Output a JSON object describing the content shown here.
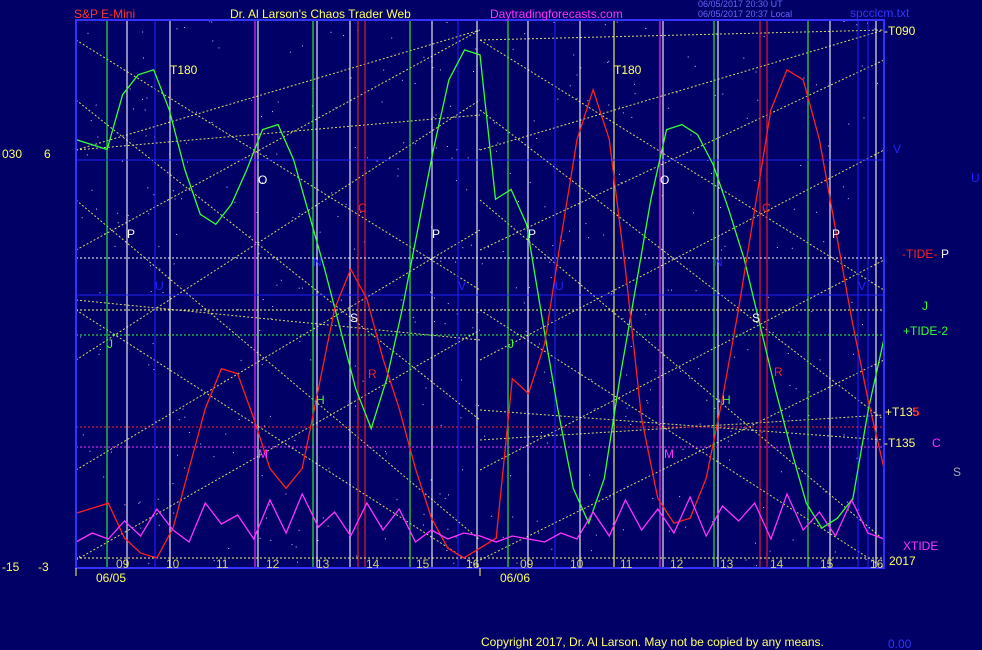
{
  "header": {
    "instrument": "S&P E-Mini",
    "site_title": "Dr. Al Larson's Chaos Trader Web",
    "site_link": "Daytradingforecasts.com",
    "timestamp_1": "06/05/2017 20:30 UT",
    "timestamp_2": "06/05/2017 20:37 Local",
    "file_name": "spcclcm.txt"
  },
  "left_axis": {
    "top_a": "030",
    "top_b": "6",
    "bottom_a": "-15",
    "bottom_b": "-3"
  },
  "right_labels": {
    "t090": "-T090",
    "v": "V",
    "u": "U",
    "tide": "-TIDE-",
    "tide_p": "P",
    "j": "J",
    "tide2": "+TIDE-2",
    "t135_plus": "+T135",
    "t135_plus_suffix": "5",
    "t135_minus": "-T135",
    "c": "C",
    "s": "S",
    "xtide": "XTIDE",
    "year": "2017"
  },
  "footer": {
    "copyright": "Copyright 2017, Dr. Al Larson. May not be copied by any means.",
    "tail": "0.00"
  },
  "colors": {
    "bg": "#000066",
    "plot_bg": "#000066",
    "frame": "#3333ff",
    "yellow": "#ffff66",
    "green": "#33ff33",
    "red": "#ff2020",
    "magenta": "#ff33ff",
    "white": "#ffffff",
    "blue": "#2222ff",
    "title_red": "#ff3333"
  },
  "chart_data": {
    "type": "line",
    "title": "S&P E-Mini",
    "dates": [
      "06/05",
      "06/06"
    ],
    "hour_ticks": [
      "09",
      "10",
      "11",
      "12",
      "13",
      "14",
      "15",
      "16"
    ],
    "flux_labels": [
      "T180",
      "T180",
      "O",
      "O",
      "N",
      "N",
      "P",
      "P",
      "P",
      "P",
      "S",
      "S",
      "C",
      "C",
      "R",
      "R",
      "H",
      "H",
      "J",
      "J",
      "M",
      "M",
      "U",
      "U",
      "V",
      "V"
    ],
    "series": [
      {
        "name": "TIDE-2",
        "color": "#33ff33",
        "values": [
          5.6,
          5.5,
          5.4,
          6.5,
          6.9,
          7.0,
          6.2,
          5.0,
          4.1,
          3.9,
          4.3,
          5.0,
          5.8,
          5.9,
          5.2,
          4.1,
          3.0,
          1.8,
          0.6,
          -0.2,
          0.8,
          2.2,
          3.8,
          5.4,
          6.8,
          7.4,
          7.3,
          4.4,
          4.6,
          3.9,
          2.0,
          0.2,
          -1.4,
          -2.1,
          -1.2,
          0.8,
          2.6,
          4.4,
          5.8,
          5.9,
          5.7,
          5.1,
          4.2,
          3.2,
          1.9,
          0.6,
          -0.6,
          -1.7,
          -2.2,
          -2.0,
          -1.6,
          0.2,
          1.6
        ]
      },
      {
        "name": "TIDE",
        "color": "#ff2020",
        "values": [
          -1.9,
          -1.8,
          -1.7,
          -2.4,
          -2.7,
          -2.8,
          -2.2,
          -1.0,
          0.2,
          1.0,
          0.9,
          0.0,
          -1.0,
          -1.4,
          -1.0,
          0.6,
          2.2,
          3.0,
          2.4,
          1.2,
          0.2,
          -1.0,
          -2.0,
          -2.6,
          -2.8,
          -2.6,
          -2.4,
          0.8,
          0.5,
          1.5,
          3.6,
          5.6,
          6.6,
          5.6,
          3.0,
          0.0,
          -1.6,
          -2.1,
          -2.0,
          -1.2,
          0.4,
          2.2,
          4.2,
          6.2,
          7.0,
          6.8,
          5.6,
          3.8,
          2.0,
          0.4,
          -1.0
        ]
      },
      {
        "name": "XTIDE",
        "color": "#ff33ff",
        "values": [
          0.2,
          0.5,
          0.3,
          0.9,
          0.4,
          1.3,
          0.6,
          0.2,
          1.5,
          0.8,
          1.1,
          0.3,
          1.6,
          0.5,
          1.8,
          0.7,
          1.2,
          0.4,
          1.5,
          0.6,
          1.3,
          0.2,
          0.6,
          0.3,
          0.5,
          0.4,
          0.2,
          0.4,
          0.3,
          0.2,
          0.5,
          0.3,
          1.2,
          0.4,
          1.6,
          0.6,
          1.3,
          0.5,
          1.7,
          0.4,
          1.4,
          0.9,
          1.5,
          0.3,
          1.8,
          0.6,
          1.2,
          0.4,
          1.6,
          0.5,
          0.3
        ]
      }
    ],
    "ylim": [
      -3,
      8
    ],
    "grid": true
  }
}
